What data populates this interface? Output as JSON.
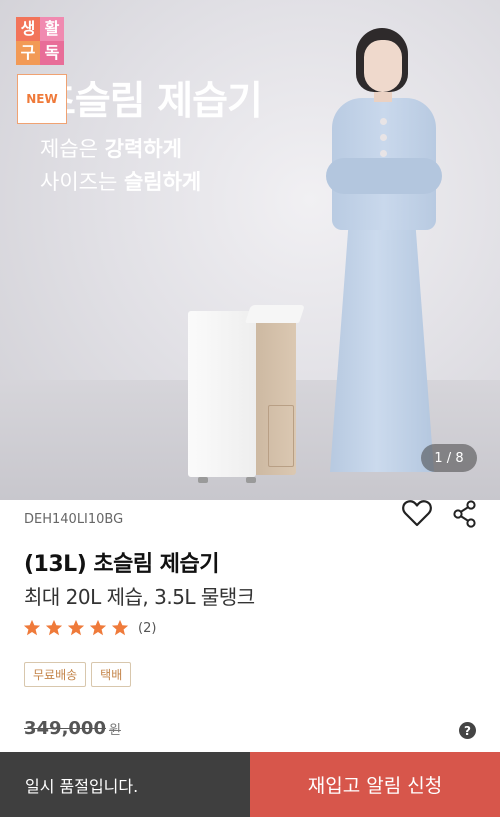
{
  "hero": {
    "badge_chars": [
      "생",
      "활",
      "구",
      "독"
    ],
    "new_badge": "NEW",
    "title": "초슬림 제습기",
    "line1_plain": "제습은 ",
    "line1_bold": "강력하게",
    "line2_plain": "사이즈는 ",
    "line2_bold": "슬림하게",
    "counter": "1 / 8"
  },
  "product": {
    "model_code": "DEH140LI10BG",
    "name": "(13L) 초슬림 제습기",
    "subtitle": "최대 20L 제습, 3.5L 물탱크",
    "rating": 5,
    "review_count": "(2)",
    "tags": [
      "무료배송",
      "택배"
    ],
    "original_price": "349,000",
    "currency": "원"
  },
  "icons": {
    "favorite": "heart-outline-icon",
    "share": "share-icon",
    "help": "question-circle-icon"
  },
  "help_symbol": "?",
  "bottom_bar": {
    "soldout_text": "일시 품절입니다.",
    "restock_button": "재입고 알림 신청"
  },
  "colors": {
    "star": "#ef7a3a",
    "restock_bg": "#d7564b",
    "soldout_bg": "#3f3f3f",
    "tag_text": "#c4854a"
  }
}
